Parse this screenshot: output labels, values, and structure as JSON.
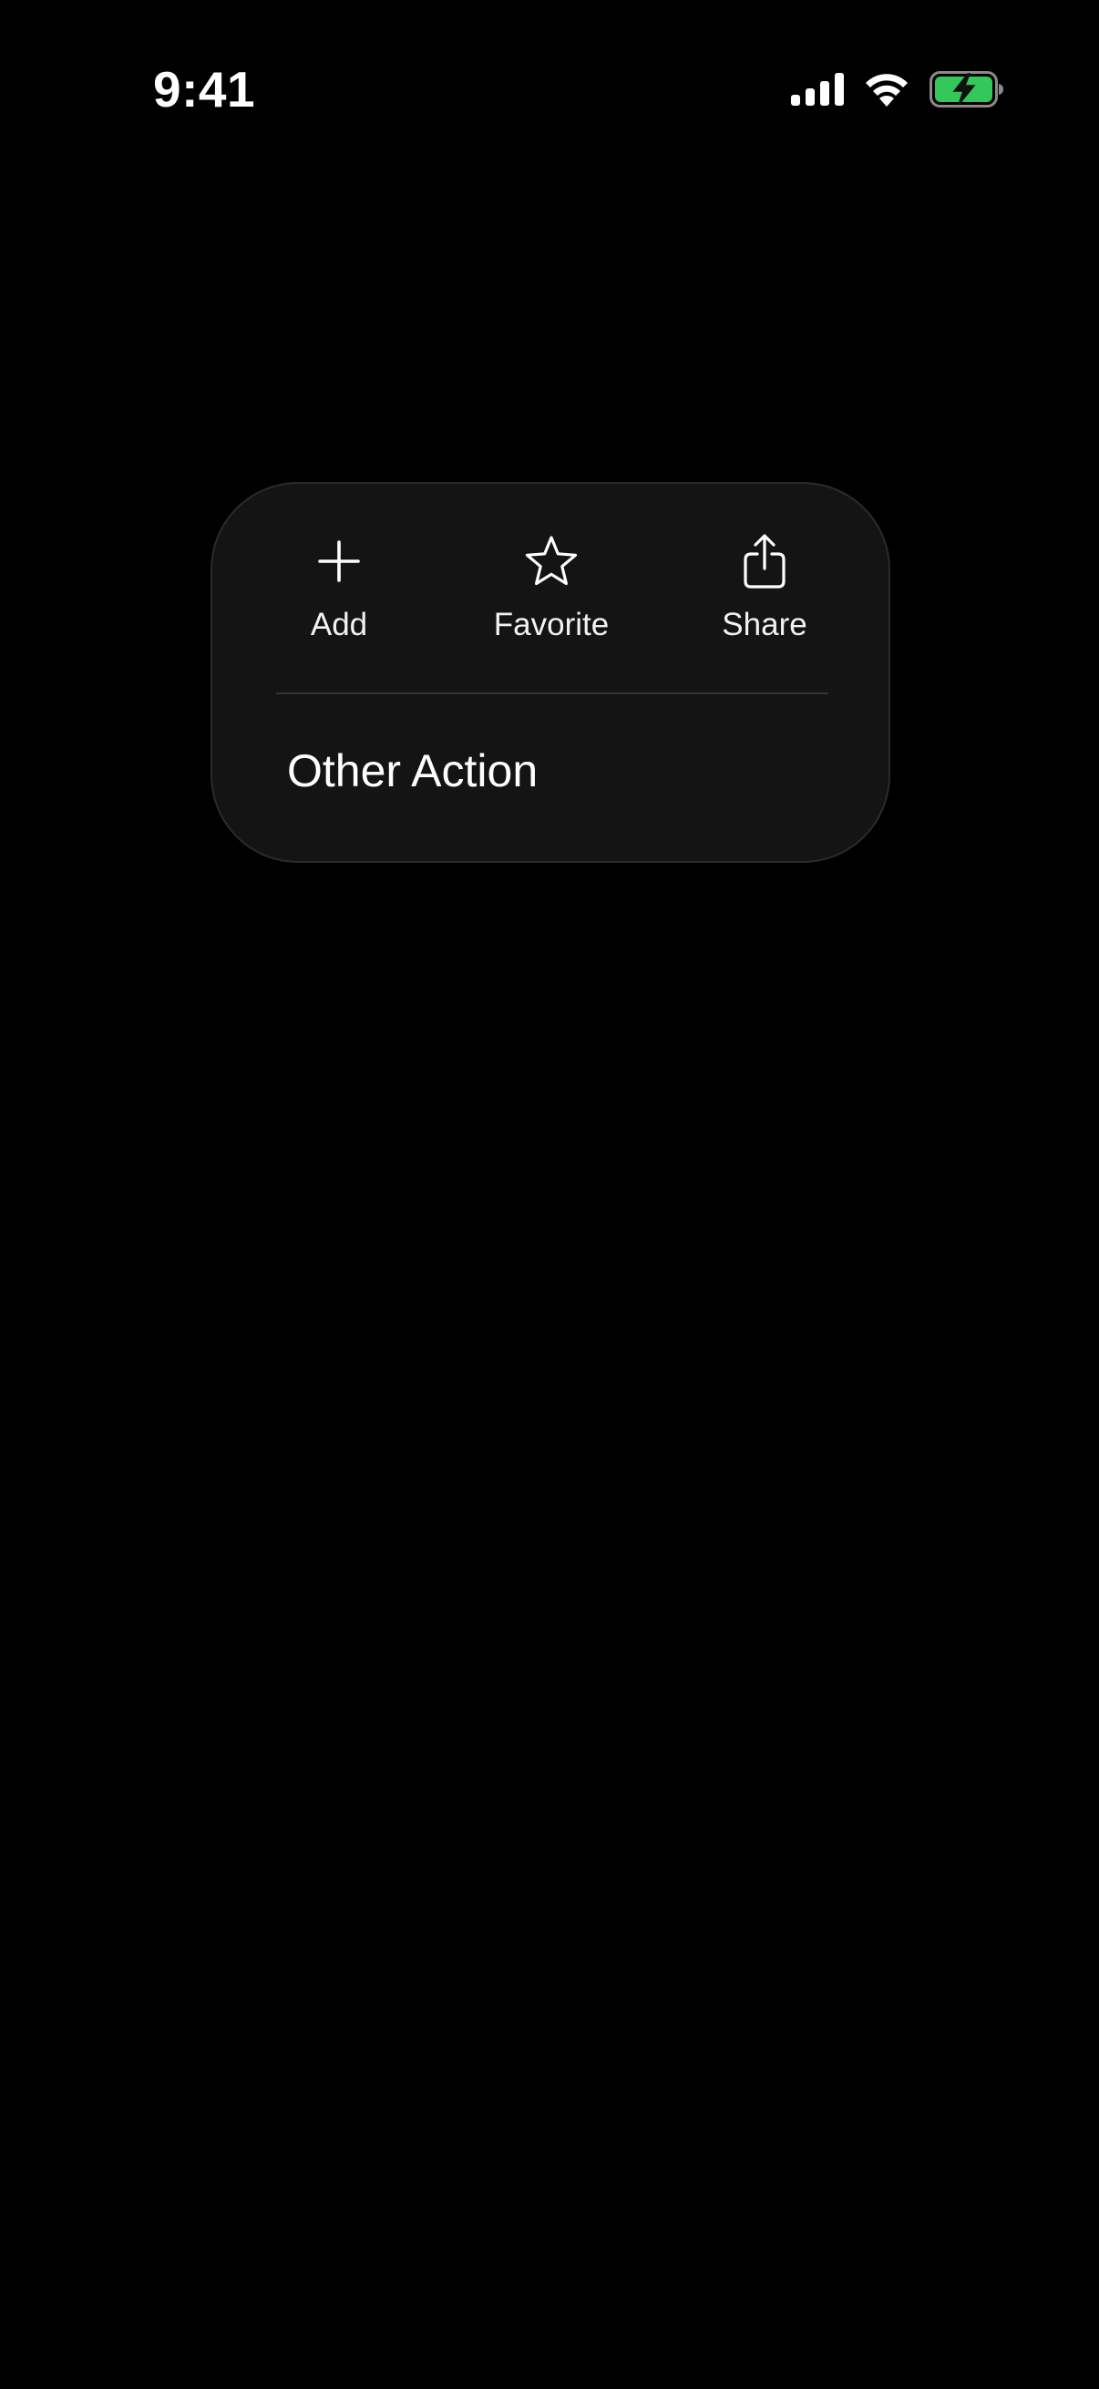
{
  "status_bar": {
    "time": "9:41",
    "icons": [
      "cellular-signal-icon",
      "wifi-icon",
      "battery-charging-icon"
    ],
    "battery_color": "#34c759"
  },
  "menu": {
    "quick_actions": [
      {
        "label": "Add",
        "icon": "plus-icon"
      },
      {
        "label": "Favorite",
        "icon": "star-icon"
      },
      {
        "label": "Share",
        "icon": "share-icon"
      }
    ],
    "items": [
      {
        "label": "Other Action"
      }
    ]
  },
  "colors": {
    "background": "#000000",
    "menu_background": "#141414",
    "text": "#ffffff"
  }
}
